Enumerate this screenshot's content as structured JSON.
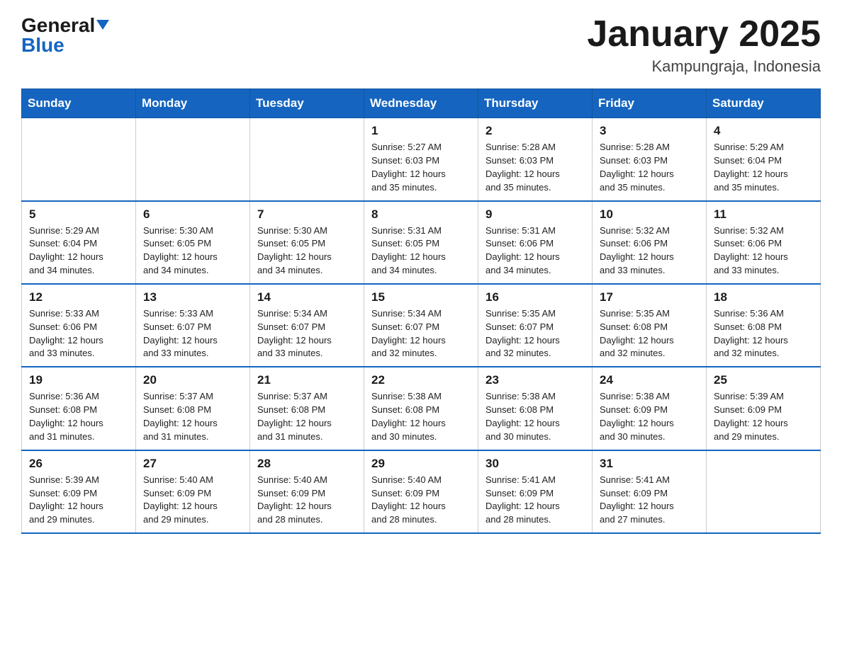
{
  "logo": {
    "general": "General",
    "blue": "Blue"
  },
  "title": "January 2025",
  "subtitle": "Kampungraja, Indonesia",
  "days_of_week": [
    "Sunday",
    "Monday",
    "Tuesday",
    "Wednesday",
    "Thursday",
    "Friday",
    "Saturday"
  ],
  "weeks": [
    [
      {
        "day": "",
        "info": ""
      },
      {
        "day": "",
        "info": ""
      },
      {
        "day": "",
        "info": ""
      },
      {
        "day": "1",
        "info": "Sunrise: 5:27 AM\nSunset: 6:03 PM\nDaylight: 12 hours\nand 35 minutes."
      },
      {
        "day": "2",
        "info": "Sunrise: 5:28 AM\nSunset: 6:03 PM\nDaylight: 12 hours\nand 35 minutes."
      },
      {
        "day": "3",
        "info": "Sunrise: 5:28 AM\nSunset: 6:03 PM\nDaylight: 12 hours\nand 35 minutes."
      },
      {
        "day": "4",
        "info": "Sunrise: 5:29 AM\nSunset: 6:04 PM\nDaylight: 12 hours\nand 35 minutes."
      }
    ],
    [
      {
        "day": "5",
        "info": "Sunrise: 5:29 AM\nSunset: 6:04 PM\nDaylight: 12 hours\nand 34 minutes."
      },
      {
        "day": "6",
        "info": "Sunrise: 5:30 AM\nSunset: 6:05 PM\nDaylight: 12 hours\nand 34 minutes."
      },
      {
        "day": "7",
        "info": "Sunrise: 5:30 AM\nSunset: 6:05 PM\nDaylight: 12 hours\nand 34 minutes."
      },
      {
        "day": "8",
        "info": "Sunrise: 5:31 AM\nSunset: 6:05 PM\nDaylight: 12 hours\nand 34 minutes."
      },
      {
        "day": "9",
        "info": "Sunrise: 5:31 AM\nSunset: 6:06 PM\nDaylight: 12 hours\nand 34 minutes."
      },
      {
        "day": "10",
        "info": "Sunrise: 5:32 AM\nSunset: 6:06 PM\nDaylight: 12 hours\nand 33 minutes."
      },
      {
        "day": "11",
        "info": "Sunrise: 5:32 AM\nSunset: 6:06 PM\nDaylight: 12 hours\nand 33 minutes."
      }
    ],
    [
      {
        "day": "12",
        "info": "Sunrise: 5:33 AM\nSunset: 6:06 PM\nDaylight: 12 hours\nand 33 minutes."
      },
      {
        "day": "13",
        "info": "Sunrise: 5:33 AM\nSunset: 6:07 PM\nDaylight: 12 hours\nand 33 minutes."
      },
      {
        "day": "14",
        "info": "Sunrise: 5:34 AM\nSunset: 6:07 PM\nDaylight: 12 hours\nand 33 minutes."
      },
      {
        "day": "15",
        "info": "Sunrise: 5:34 AM\nSunset: 6:07 PM\nDaylight: 12 hours\nand 32 minutes."
      },
      {
        "day": "16",
        "info": "Sunrise: 5:35 AM\nSunset: 6:07 PM\nDaylight: 12 hours\nand 32 minutes."
      },
      {
        "day": "17",
        "info": "Sunrise: 5:35 AM\nSunset: 6:08 PM\nDaylight: 12 hours\nand 32 minutes."
      },
      {
        "day": "18",
        "info": "Sunrise: 5:36 AM\nSunset: 6:08 PM\nDaylight: 12 hours\nand 32 minutes."
      }
    ],
    [
      {
        "day": "19",
        "info": "Sunrise: 5:36 AM\nSunset: 6:08 PM\nDaylight: 12 hours\nand 31 minutes."
      },
      {
        "day": "20",
        "info": "Sunrise: 5:37 AM\nSunset: 6:08 PM\nDaylight: 12 hours\nand 31 minutes."
      },
      {
        "day": "21",
        "info": "Sunrise: 5:37 AM\nSunset: 6:08 PM\nDaylight: 12 hours\nand 31 minutes."
      },
      {
        "day": "22",
        "info": "Sunrise: 5:38 AM\nSunset: 6:08 PM\nDaylight: 12 hours\nand 30 minutes."
      },
      {
        "day": "23",
        "info": "Sunrise: 5:38 AM\nSunset: 6:08 PM\nDaylight: 12 hours\nand 30 minutes."
      },
      {
        "day": "24",
        "info": "Sunrise: 5:38 AM\nSunset: 6:09 PM\nDaylight: 12 hours\nand 30 minutes."
      },
      {
        "day": "25",
        "info": "Sunrise: 5:39 AM\nSunset: 6:09 PM\nDaylight: 12 hours\nand 29 minutes."
      }
    ],
    [
      {
        "day": "26",
        "info": "Sunrise: 5:39 AM\nSunset: 6:09 PM\nDaylight: 12 hours\nand 29 minutes."
      },
      {
        "day": "27",
        "info": "Sunrise: 5:40 AM\nSunset: 6:09 PM\nDaylight: 12 hours\nand 29 minutes."
      },
      {
        "day": "28",
        "info": "Sunrise: 5:40 AM\nSunset: 6:09 PM\nDaylight: 12 hours\nand 28 minutes."
      },
      {
        "day": "29",
        "info": "Sunrise: 5:40 AM\nSunset: 6:09 PM\nDaylight: 12 hours\nand 28 minutes."
      },
      {
        "day": "30",
        "info": "Sunrise: 5:41 AM\nSunset: 6:09 PM\nDaylight: 12 hours\nand 28 minutes."
      },
      {
        "day": "31",
        "info": "Sunrise: 5:41 AM\nSunset: 6:09 PM\nDaylight: 12 hours\nand 27 minutes."
      },
      {
        "day": "",
        "info": ""
      }
    ]
  ]
}
